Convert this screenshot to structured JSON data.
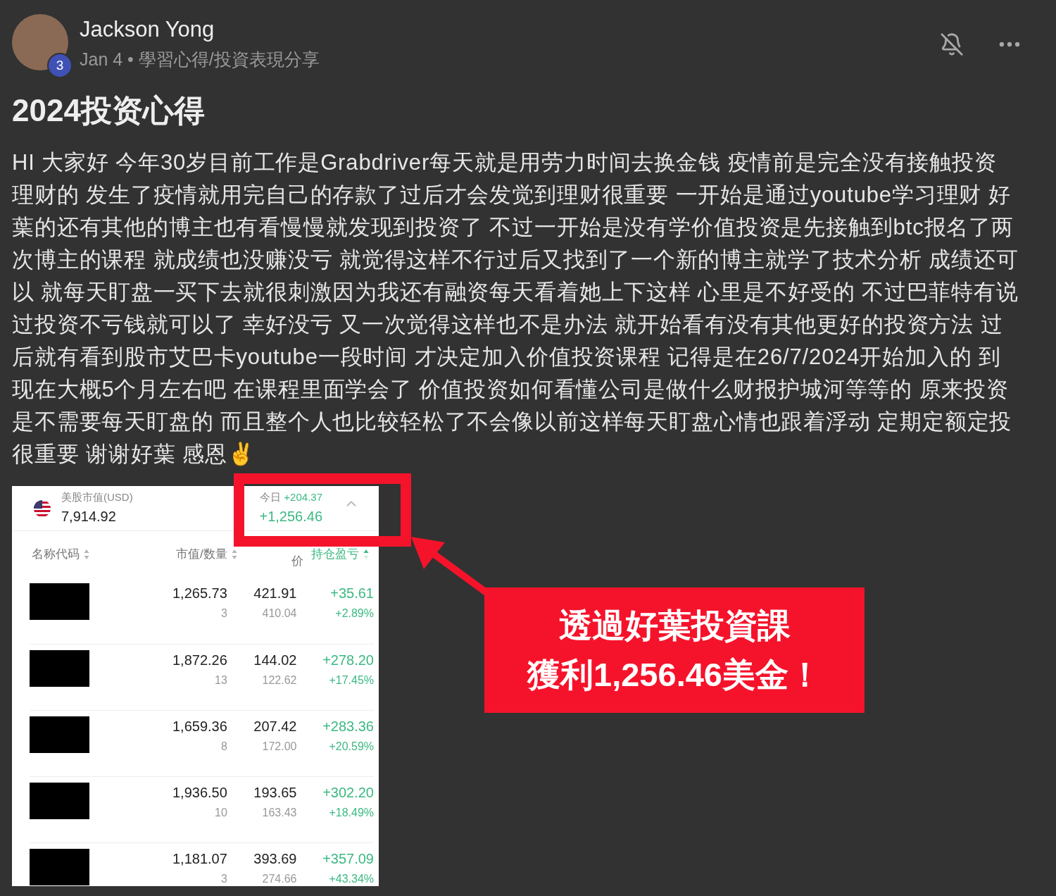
{
  "post": {
    "author": "Jackson Yong",
    "badge": "3",
    "meta": "Jan 4 • 學習心得/投資表現分享",
    "title": "2024投资心得",
    "body": "HI 大家好 今年30岁目前工作是Grabdriver每天就是用劳力时间去换金钱 疫情前是完全没有接触投资理财的 发生了疫情就用完自己的存款了过后才会发觉到理财很重要 一开始是通过youtube学习理财 好葉的还有其他的博主也有看慢慢就发现到投资了 不过一开始是没有学价值投资是先接触到btc报名了两次博主的课程 就成绩也没赚没亏 就觉得这样不行过后又找到了一个新的博主就学了技术分析 成绩还可以 就每天盯盘一买下去就很刺激因为我还有融资每天看着她上下这样 心里是不好受的 不过巴菲特有说过投资不亏钱就可以了 幸好没亏 又一次觉得这样也不是办法 就开始看有没有其他更好的投资方法 过后就有看到股市艾巴卡youtube一段时间 才决定加入价值投资课程 记得是在26/7/2024开始加入的 到现在大概5个月左右吧 在课程里面学会了 价值投资如何看懂公司是做什么财报护城河等等的 原来投资是不需要每天盯盘的 而且整个人也比较轻松了不会像以前这样每天盯盘心情也跟着浮动 定期定额定投很重要 谢谢好葉 感恩✌"
  },
  "screenshot": {
    "market_label": "美股市值(USD)",
    "market_value": "7,914.92",
    "today_label": "今日",
    "today_change": "+204.37",
    "total_change": "+1,256.46",
    "columns": [
      {
        "label": "名称代码",
        "selected": false
      },
      {
        "label": "市值/数量",
        "selected": false
      },
      {
        "label": "价",
        "selected": false
      },
      {
        "label": "持仓盈亏",
        "selected": true
      }
    ],
    "rows": [
      {
        "value": "1,265.73",
        "quantity": "3",
        "price": "421.91",
        "cost": "410.04",
        "pnl": "+35.61",
        "pnl_pct": "+2.89%"
      },
      {
        "value": "1,872.26",
        "quantity": "13",
        "price": "144.02",
        "cost": "122.62",
        "pnl": "+278.20",
        "pnl_pct": "+17.45%"
      },
      {
        "value": "1,659.36",
        "quantity": "8",
        "price": "207.42",
        "cost": "172.00",
        "pnl": "+283.36",
        "pnl_pct": "+20.59%"
      },
      {
        "value": "1,936.50",
        "quantity": "10",
        "price": "193.65",
        "cost": "163.43",
        "pnl": "+302.20",
        "pnl_pct": "+18.49%"
      },
      {
        "value": "1,181.07",
        "quantity": "3",
        "price": "393.69",
        "cost": "274.66",
        "pnl": "+357.09",
        "pnl_pct": "+43.34%"
      }
    ]
  },
  "callout": {
    "lines": [
      "透過好葉投資課",
      "獲利1,256.46美金！"
    ]
  }
}
